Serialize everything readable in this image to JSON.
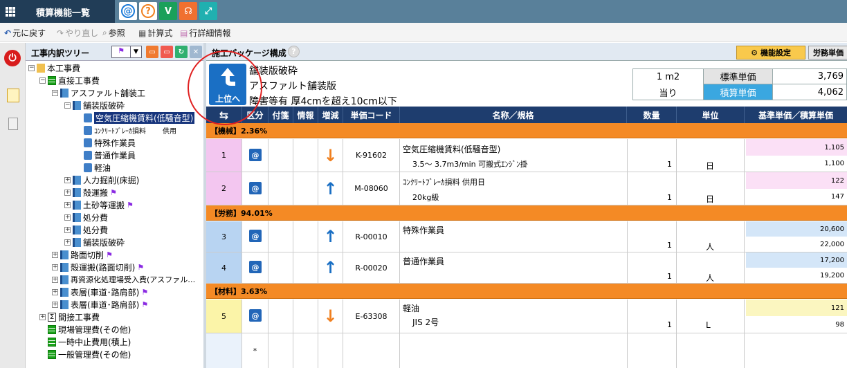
{
  "app": {
    "title": "積算機能一覧"
  },
  "toolbar": {
    "undo": "元に戻す",
    "redo": "やり直し",
    "ref": "参照",
    "calc": "計算式",
    "row_detail": "行詳細情報"
  },
  "tree": {
    "title": "工事内訳ツリー",
    "nodes": [
      {
        "label": "本工事費"
      },
      {
        "label": "直接工事費"
      },
      {
        "label": "アスファルト舗装工"
      },
      {
        "label": "舗装版破砕"
      },
      {
        "label": "空気圧縮機賃料(低騒音型)"
      },
      {
        "label": "ｺﾝｸﾘｰﾄﾌﾞﾚｰｶ損料",
        "suffix": "供用"
      },
      {
        "label": "特殊作業員"
      },
      {
        "label": "普通作業員"
      },
      {
        "label": "軽油"
      },
      {
        "label": "人力掘削(床掘)"
      },
      {
        "label": "殻運搬"
      },
      {
        "label": "土砂等運搬"
      },
      {
        "label": "処分費"
      },
      {
        "label": "処分費"
      },
      {
        "label": "舗装版破砕"
      },
      {
        "label": "路面切削"
      },
      {
        "label": "殻運搬(路面切削)"
      },
      {
        "label": "再資源化処理場受入費(アスファル…"
      },
      {
        "label": "表層(車道･路肩部)"
      },
      {
        "label": "表層(車道･路肩部)"
      },
      {
        "label": "間接工事費"
      },
      {
        "label": "現場管理費(その他)"
      },
      {
        "label": "一時中止費用(積上)"
      },
      {
        "label": "一般管理費(その他)"
      }
    ]
  },
  "main": {
    "title": "施工パッケージ構成",
    "help": "?",
    "btn_setting": "機能設定",
    "btn_labor": "労務単価",
    "up_label": "上位へ",
    "pkg_name": "舗装版破砕",
    "pkg_type": "アスファルト舗装版",
    "pkg_cond": "障害等有  厚4cmを超え10cm以下",
    "unit_qty": "1 m2",
    "unit_per": "当り",
    "std_label": "標準単価",
    "std_value": "3,769",
    "est_label": "積算単価",
    "est_value": "4,062"
  },
  "table": {
    "headers": {
      "swap": "⇆",
      "kubun": "区分",
      "fusen": "付箋",
      "jouhou": "情報",
      "zougen": "増減",
      "code": "単価コード",
      "name": "名称／規格",
      "qty": "数量",
      "unit": "単位",
      "price": "基準単価／積算単価"
    },
    "sections": [
      {
        "label": "【機械】2.36%"
      },
      {
        "label": "【労務】94.01%"
      },
      {
        "label": "【材料】3.63%"
      }
    ],
    "rows": [
      {
        "no": "1",
        "code": "K-91602",
        "name": "空気圧縮機賃料(低騒音型)",
        "spec": "3.5～ 3.7m3/min 可搬式ｴﾝｼﾞﾝ掛",
        "qty": "1",
        "unit": "日",
        "p1": "1,105",
        "p2": "1,100"
      },
      {
        "no": "2",
        "code": "M-08060",
        "name": "ｺﾝｸﾘｰﾄﾌﾞﾚｰｶ損料          供用日",
        "spec": "20kg級",
        "qty": "1",
        "unit": "日",
        "p1": "122",
        "p2": "147"
      },
      {
        "no": "3",
        "code": "R-00010",
        "name": "特殊作業員",
        "spec": "",
        "qty": "1",
        "unit": "人",
        "p1": "20,600",
        "p2": "22,000"
      },
      {
        "no": "4",
        "code": "R-00020",
        "name": "普通作業員",
        "spec": "",
        "qty": "1",
        "unit": "人",
        "p1": "17,200",
        "p2": "19,200"
      },
      {
        "no": "5",
        "code": "E-63308",
        "name": "軽油",
        "spec": "JIS 2号",
        "qty": "1",
        "unit": "L",
        "p1": "121",
        "p2": "98"
      }
    ],
    "new_row": "*"
  },
  "colors": {
    "accent": "#1a6fc4",
    "section": "#f48a25",
    "header": "#1e3d6e"
  }
}
